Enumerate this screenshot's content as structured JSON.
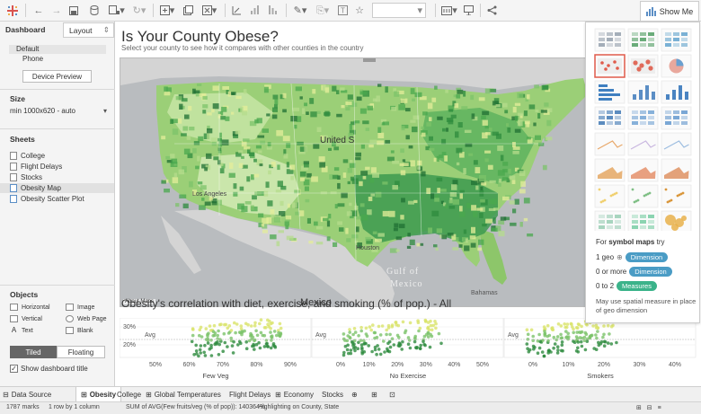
{
  "toolbar": {
    "show_me_label": "Show Me"
  },
  "leftpane": {
    "tabs": [
      "Dashboard",
      "Layout"
    ],
    "devices": [
      "Default",
      "Phone"
    ],
    "device_preview_label": "Device Preview",
    "size_heading": "Size",
    "size_value": "min 1000x620 - auto",
    "sheets_heading": "Sheets",
    "sheets": [
      "College",
      "Flight Delays",
      "Stocks",
      "Obesity Map",
      "Obesity Scatter Plot"
    ],
    "objects_heading": "Objects",
    "objects": [
      "Horizontal",
      "Image",
      "Vertical",
      "Web Page",
      "Text",
      "Blank"
    ],
    "tiled_label": "Tiled",
    "floating_label": "Floating",
    "show_title_label": "Show dashboard title"
  },
  "dashboard": {
    "title": "Is Your County Obese?",
    "subtitle": "Select your county to see how it compares with other counties in the country",
    "map": {
      "labels": {
        "country": "United S",
        "los_angeles": "Los Angeles",
        "houston": "Houston",
        "gulf": "Gulf of",
        "gulf2": "Mexico",
        "mexico": "Mexico",
        "bahamas": "Bahamas",
        "attribution": "About Maps"
      }
    },
    "correlation_title": "Obesity's correlation with diet, exercise, and smoking (% of pop.) - All"
  },
  "chart_data": [
    {
      "type": "scatter",
      "xlabel": "Few Veg",
      "x_ticks": [
        "50%",
        "60%",
        "70%",
        "80%",
        "90%"
      ],
      "y_ticks": [
        "30%",
        "20%"
      ],
      "annotation": "Avg"
    },
    {
      "type": "scatter",
      "xlabel": "No Exercise",
      "x_ticks": [
        "0%",
        "10%",
        "20%",
        "30%",
        "40%",
        "50%"
      ],
      "annotation": "Avg"
    },
    {
      "type": "scatter",
      "xlabel": "Smokers",
      "x_ticks": [
        "0%",
        "10%",
        "20%",
        "30%",
        "40%"
      ],
      "annotation": "Avg"
    }
  ],
  "showme": {
    "hint_prefix": "For ",
    "hint_bold": "symbol maps",
    "hint_suffix": " try",
    "rows": [
      {
        "label": "1 geo",
        "pill": "Dimension",
        "color": "#4a9cc5"
      },
      {
        "label": "0 or more",
        "pill": "Dimension",
        "color": "#4a9cc5"
      },
      {
        "label": "0 to 2",
        "pill": "Measures",
        "color": "#3bb38a"
      }
    ],
    "note": "May use spatial measure in place of geo dimension"
  },
  "tabs": [
    "Data Source",
    "Obesity",
    "College",
    "Global Temperatures",
    "Flight Delays",
    "Economy",
    "Stocks"
  ],
  "status": {
    "marks": "1787 marks",
    "rows": "1 row by 1 column",
    "sum": "SUM of AVG(Few fruits/veg (% of pop)): 140364%",
    "highlight": "Highlighting on County, State"
  }
}
